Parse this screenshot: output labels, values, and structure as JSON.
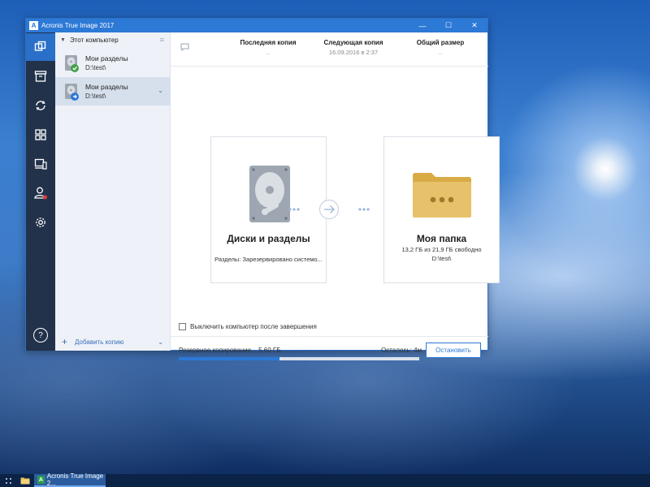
{
  "window": {
    "title": "Acronis True Image 2017",
    "logo_letter": "A",
    "buttons": {
      "minimize": "—",
      "maximize": "☐",
      "close": "✕"
    }
  },
  "rail": {
    "items": [
      {
        "name": "backup-icon"
      },
      {
        "name": "archive-icon"
      },
      {
        "name": "sync-icon"
      },
      {
        "name": "dashboard-icon"
      },
      {
        "name": "tools-icon"
      },
      {
        "name": "account-icon"
      },
      {
        "name": "settings-icon"
      }
    ],
    "help": "?"
  },
  "sidebar": {
    "header": "Этот компьютер",
    "items": [
      {
        "name": "Мои разделы",
        "path": "D:\\test\\",
        "status": "ok"
      },
      {
        "name": "Мои разделы",
        "path": "D:\\test\\",
        "status": "running"
      }
    ],
    "add_label": "Добавить копию"
  },
  "info": {
    "last_label": "Последняя копия",
    "last_value": "..",
    "next_label": "Следующая копия",
    "next_value": "16.09.2016 в 2:37",
    "size_label": "Общий размер",
    "size_value": ".."
  },
  "source": {
    "title": "Диски и разделы",
    "detail": "Разделы: Зарезервировано системо..."
  },
  "destination": {
    "title": "Моя папка",
    "detail": "13,2 ГБ из 21,9 ГБ свободно",
    "path": "D:\\test\\"
  },
  "shutdown_label": "Выключить компьютер после завершения",
  "progress": {
    "text": "Резервное копирование...  5,60 ГБ",
    "remaining": "Осталось: 4м",
    "fraction": 0.42,
    "stop_label": "Остановить"
  },
  "taskbar": {
    "app_label": "Acronis True Image 2..."
  },
  "colors": {
    "accent": "#2c79d6",
    "rail": "#22324b",
    "folder": "#e7c26a",
    "ok": "#4caf50"
  }
}
